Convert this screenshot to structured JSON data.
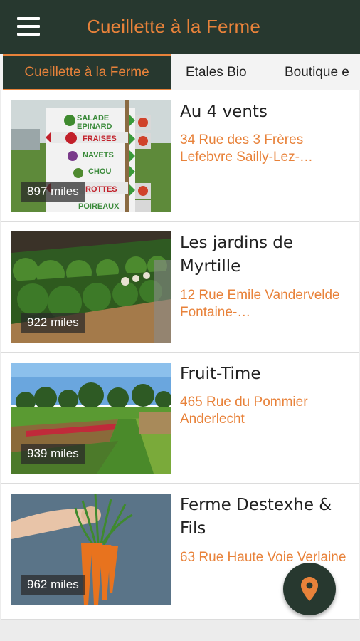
{
  "app": {
    "title": "Cueillette à la Ferme"
  },
  "tabs": [
    {
      "label": "Cueillette à la Ferme",
      "active": true
    },
    {
      "label": "Etales Bio",
      "active": false
    },
    {
      "label": "Boutique e",
      "active": false
    }
  ],
  "farms": [
    {
      "name": "Au 4 vents",
      "address": "34 Rue des 3 Frères Lefebvre Sailly-Lez-…",
      "distance": "897 miles",
      "sign_labels": [
        "SALADE",
        "EPINARD",
        "FRAISES",
        "NAVETS",
        "CHOU",
        "ROTTES",
        "POIREAUX"
      ]
    },
    {
      "name": "Les jardins de Myrtille",
      "address": "12 Rue Emile Vandervelde Fontaine-…",
      "distance": "922 miles"
    },
    {
      "name": "Fruit-Time",
      "address": "465 Rue du Pommier Anderlecht",
      "distance": "939 miles"
    },
    {
      "name": "Ferme Destexhe & Fils",
      "address": "63 Rue Haute Voie Verlaine",
      "distance": "962 miles"
    }
  ],
  "colors": {
    "appbar": "#27382f",
    "accent": "#e8823a"
  },
  "icons": {
    "menu": "menu-icon",
    "map_marker": "map-marker-icon"
  }
}
